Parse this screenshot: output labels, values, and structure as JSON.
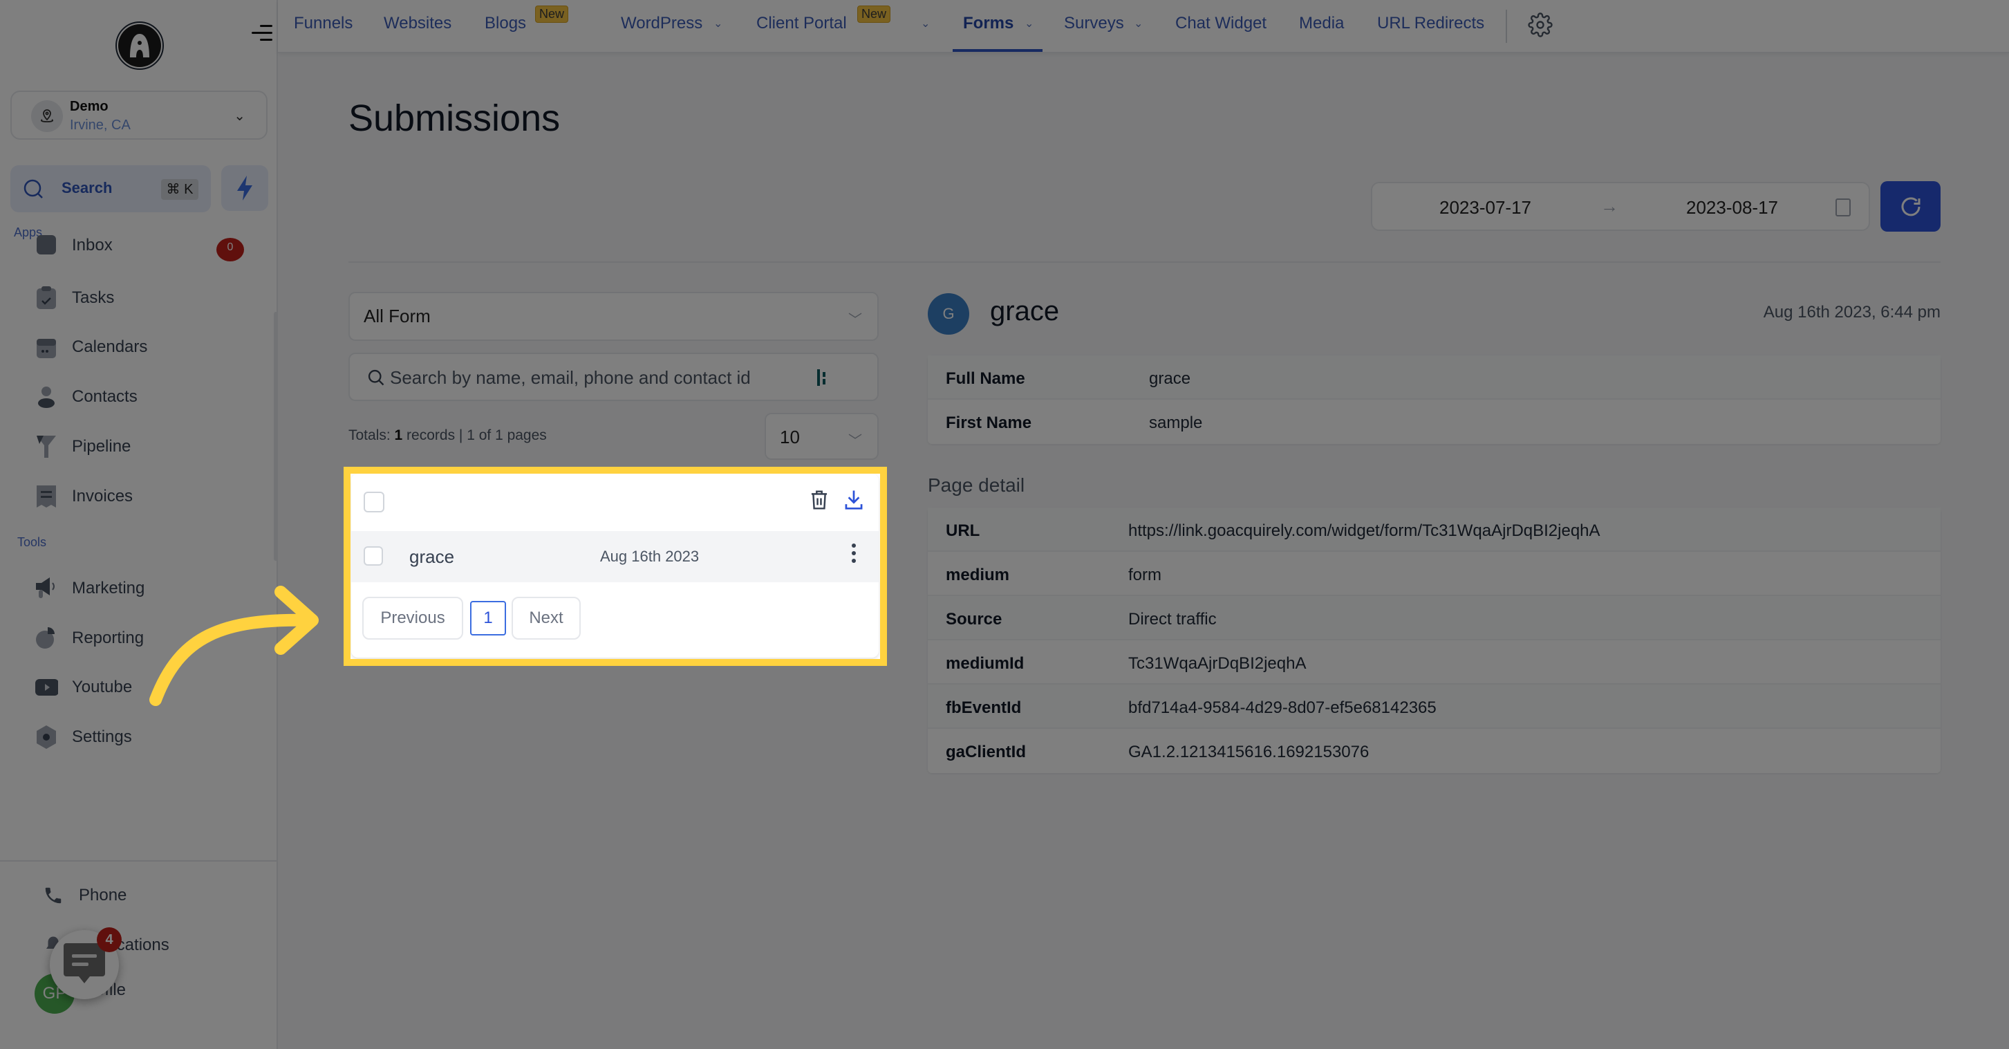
{
  "sidebar": {
    "location": {
      "name": "Demo",
      "city": "Irvine, CA"
    },
    "search": {
      "label": "Search",
      "shortcut": "⌘ K"
    },
    "apps_label": "Apps",
    "apps": [
      {
        "label": "Inbox",
        "badge": "0"
      },
      {
        "label": "Tasks"
      },
      {
        "label": "Calendars"
      },
      {
        "label": "Contacts"
      },
      {
        "label": "Pipeline"
      },
      {
        "label": "Invoices"
      }
    ],
    "tools_label": "Tools",
    "tools": [
      {
        "label": "Marketing"
      },
      {
        "label": "Reporting"
      },
      {
        "label": "Youtube"
      },
      {
        "label": "Settings"
      }
    ],
    "bottom": [
      {
        "label": "Phone"
      },
      {
        "label": "Notifications"
      },
      {
        "label": "Profile",
        "avatar_initials": "GP"
      }
    ],
    "chat_badge": "4"
  },
  "topnav": {
    "items": [
      {
        "label": "Funnels"
      },
      {
        "label": "Websites"
      },
      {
        "label": "Blogs",
        "badge": "New"
      },
      {
        "label": "WordPress",
        "dropdown": true
      },
      {
        "label": "Client Portal",
        "badge": "New",
        "dropdown": true
      },
      {
        "label": "Forms",
        "dropdown": true,
        "active": true
      },
      {
        "label": "Surveys",
        "dropdown": true
      },
      {
        "label": "Chat Widget"
      },
      {
        "label": "Media"
      },
      {
        "label": "URL Redirects"
      }
    ]
  },
  "page": {
    "title": "Submissions",
    "date_range": {
      "start": "2023-07-17",
      "arrow": "→",
      "end": "2023-08-17"
    }
  },
  "filters": {
    "form_select": "All Form",
    "search_placeholder": "Search by name, email, phone and contact id",
    "totals_prefix": "Totals: ",
    "totals_count": "1",
    "totals_suffix": " records | 1 of 1 pages",
    "per_page": "10"
  },
  "list": {
    "rows": [
      {
        "name": "grace",
        "date": "Aug 16th 2023"
      }
    ],
    "pagination": {
      "previous": "Previous",
      "current": "1",
      "next": "Next"
    }
  },
  "detail": {
    "avatar_initial": "G",
    "name": "grace",
    "timestamp": "Aug 16th 2023, 6:44 pm",
    "fields": [
      {
        "key": "Full Name",
        "value": "grace"
      },
      {
        "key": "First Name",
        "value": "sample"
      }
    ],
    "page_detail_label": "Page detail",
    "page_detail": [
      {
        "key": "URL",
        "value": "https://link.goacquirely.com/widget/form/Tc31WqaAjrDqBI2jeqhA"
      },
      {
        "key": "medium",
        "value": "form"
      },
      {
        "key": "Source",
        "value": "Direct traffic"
      },
      {
        "key": "mediumId",
        "value": "Tc31WqaAjrDqBI2jeqhA"
      },
      {
        "key": "fbEventId",
        "value": "bfd714a4-9584-4d29-8d07-ef5e68142365"
      },
      {
        "key": "gaClientId",
        "value": "GA1.2.1213415616.1692153076"
      }
    ]
  },
  "colors": {
    "accent": "#2c52d8",
    "highlight": "#ffd23f",
    "badge_red": "#c0201a",
    "new_badge": "#f5c242"
  }
}
